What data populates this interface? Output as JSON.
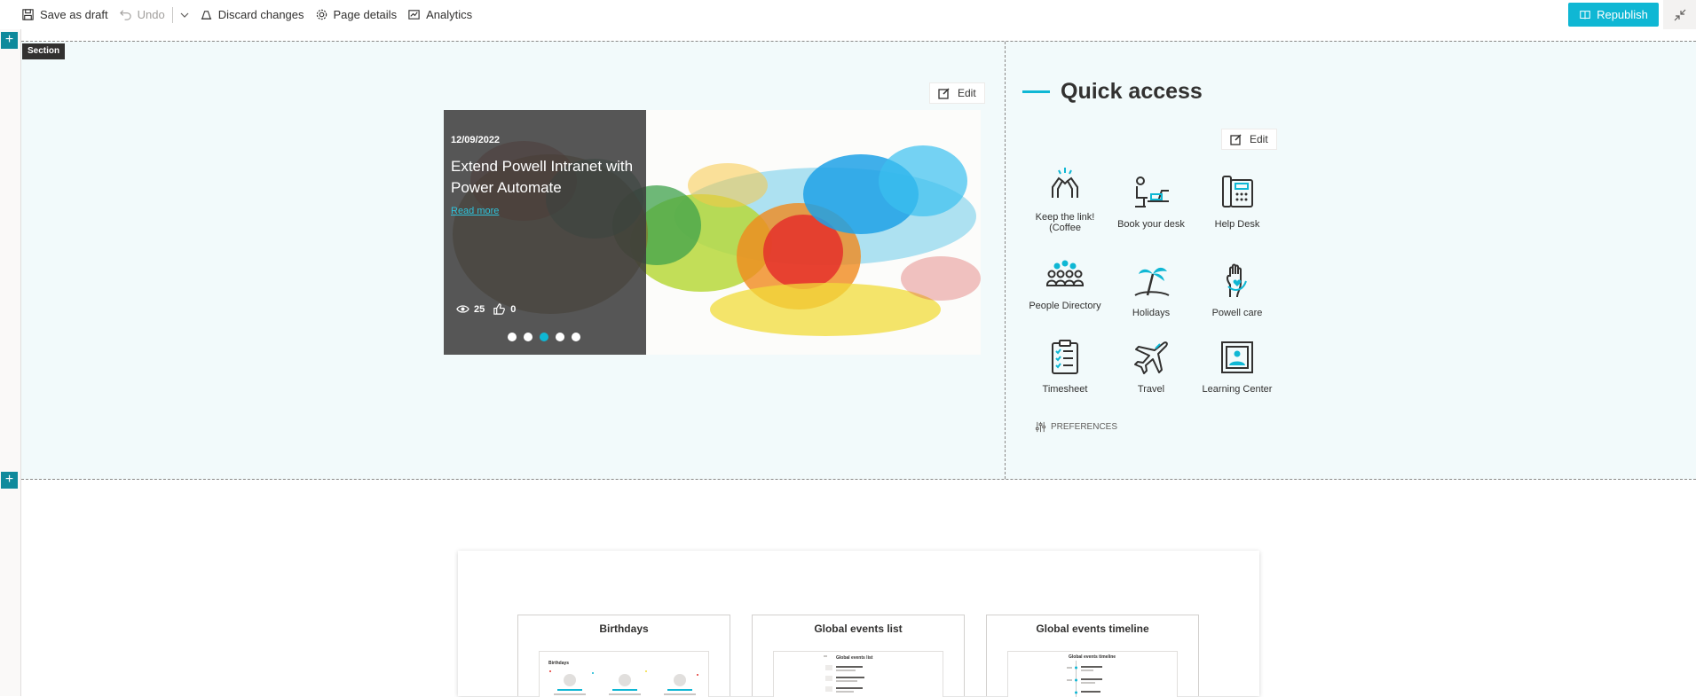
{
  "toolbar": {
    "save_draft": "Save as draft",
    "undo": "Undo",
    "discard": "Discard changes",
    "page_details": "Page details",
    "analytics": "Analytics",
    "republish": "Republish"
  },
  "section": {
    "tag": "Section"
  },
  "news": {
    "edit_label": "Edit",
    "date": "12/09/2022",
    "title": "Extend Powell Intranet with Power Automate",
    "read_more": "Read more",
    "views": "25",
    "likes": "0",
    "slides": 5,
    "active_slide": 3
  },
  "quick_access": {
    "title": "Quick access",
    "edit_label": "Edit",
    "items": [
      {
        "label": "Keep the link! (Coffee",
        "icon": "high-five-icon"
      },
      {
        "label": "Book your desk",
        "icon": "desk-icon"
      },
      {
        "label": "Help Desk",
        "icon": "phone-icon"
      },
      {
        "label": "People Directory",
        "icon": "people-icon"
      },
      {
        "label": "Holidays",
        "icon": "palm-tree-icon"
      },
      {
        "label": "Powell care",
        "icon": "caring-hand-icon"
      },
      {
        "label": "Timesheet",
        "icon": "checklist-icon"
      },
      {
        "label": "Travel",
        "icon": "airplane-icon"
      },
      {
        "label": "Learning Center",
        "icon": "picture-icon"
      }
    ],
    "preferences": "PREFERENCES"
  },
  "templates": [
    {
      "title": "Birthdays",
      "thumb_title": "Birthdays"
    },
    {
      "title": "Global events list",
      "thumb_title": "Global events list"
    },
    {
      "title": "Global events timeline",
      "thumb_title": "Global events timeline"
    }
  ],
  "colors": {
    "accent": "#0fb7d4",
    "section_bg": "#f2fafb",
    "add_button": "#0f8a9c"
  }
}
